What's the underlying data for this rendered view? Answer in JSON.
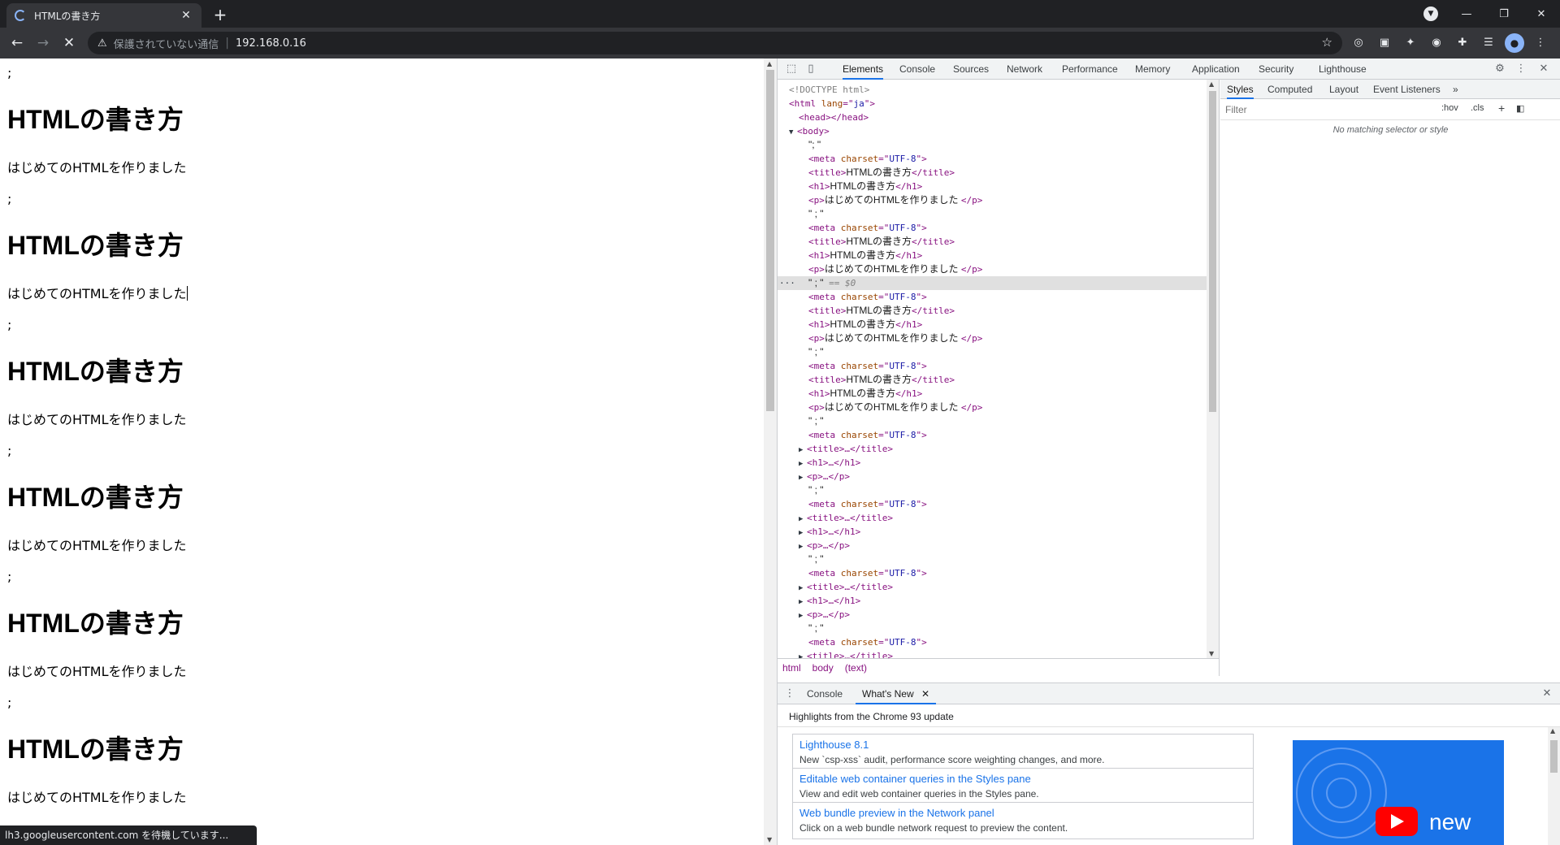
{
  "browser": {
    "tab_title": "HTMLの書き方",
    "tab_close": "✕",
    "new_tab": "+",
    "security_label": "保護されていない通信",
    "url": "192.168.0.16",
    "status_text": "lh3.googleusercontent.com を待機しています..."
  },
  "page": {
    "blocks": [
      {
        "semi": ";",
        "h1": "HTMLの書き方",
        "p": "はじめてのHTMLを作りました"
      },
      {
        "semi": ";",
        "h1": "HTMLの書き方",
        "p": "はじめてのHTMLを作りました"
      },
      {
        "semi": ";",
        "h1": "HTMLの書き方",
        "p": "はじめてのHTMLを作りました"
      },
      {
        "semi": ";",
        "h1": "HTMLの書き方",
        "p": "はじめてのHTMLを作りました"
      },
      {
        "semi": ";",
        "h1": "HTMLの書き方",
        "p": "はじめてのHTMLを作りました"
      },
      {
        "semi": ";",
        "h1": "HTMLの書き方",
        "p": "はじめてのHTMLを作りました"
      }
    ],
    "trailing_semi": ";"
  },
  "devtools": {
    "tabs": [
      "Elements",
      "Console",
      "Sources",
      "Network",
      "Performance",
      "Memory",
      "Application",
      "Security",
      "Lighthouse"
    ],
    "active_tab": "Elements",
    "dom_lines": [
      {
        "indent": 0,
        "kind": "comment",
        "text": "<!DOCTYPE html>"
      },
      {
        "indent": 0,
        "kind": "open",
        "tag": "html",
        "attr": "lang",
        "val": "ja"
      },
      {
        "indent": 1,
        "kind": "pair",
        "tag": "head",
        "inner": ""
      },
      {
        "indent": 0,
        "kind": "expanded",
        "tag": "body"
      },
      {
        "indent": 2,
        "kind": "text",
        "text": "\"; \""
      },
      {
        "indent": 2,
        "kind": "meta",
        "tag": "meta",
        "attr": "charset",
        "val": "UTF-8"
      },
      {
        "indent": 2,
        "kind": "pair",
        "tag": "title",
        "inner": "HTMLの書き方"
      },
      {
        "indent": 2,
        "kind": "pair",
        "tag": "h1",
        "inner": "HTMLの書き方"
      },
      {
        "indent": 2,
        "kind": "pair",
        "tag": "p",
        "inner": "はじめてのHTMLを作りました "
      },
      {
        "indent": 2,
        "kind": "text",
        "text": "\" ; \""
      },
      {
        "indent": 2,
        "kind": "meta",
        "tag": "meta",
        "attr": "charset",
        "val": "UTF-8"
      },
      {
        "indent": 2,
        "kind": "pair",
        "tag": "title",
        "inner": "HTMLの書き方"
      },
      {
        "indent": 2,
        "kind": "pair",
        "tag": "h1",
        "inner": "HTMLの書き方"
      },
      {
        "indent": 2,
        "kind": "pair",
        "tag": "p",
        "inner": "はじめてのHTMLを作りました "
      },
      {
        "indent": 2,
        "kind": "selected",
        "text": "\" ; \"",
        "suffix": "== $0"
      },
      {
        "indent": 2,
        "kind": "meta",
        "tag": "meta",
        "attr": "charset",
        "val": "UTF-8"
      },
      {
        "indent": 2,
        "kind": "pair",
        "tag": "title",
        "inner": "HTMLの書き方"
      },
      {
        "indent": 2,
        "kind": "pair",
        "tag": "h1",
        "inner": "HTMLの書き方"
      },
      {
        "indent": 2,
        "kind": "pair",
        "tag": "p",
        "inner": "はじめてのHTMLを作りました "
      },
      {
        "indent": 2,
        "kind": "text",
        "text": "\" ; \""
      },
      {
        "indent": 2,
        "kind": "meta",
        "tag": "meta",
        "attr": "charset",
        "val": "UTF-8"
      },
      {
        "indent": 2,
        "kind": "pair",
        "tag": "title",
        "inner": "HTMLの書き方"
      },
      {
        "indent": 2,
        "kind": "pair",
        "tag": "h1",
        "inner": "HTMLの書き方"
      },
      {
        "indent": 2,
        "kind": "pair",
        "tag": "p",
        "inner": "はじめてのHTMLを作りました "
      },
      {
        "indent": 2,
        "kind": "text",
        "text": "\" ; \""
      },
      {
        "indent": 2,
        "kind": "meta",
        "tag": "meta",
        "attr": "charset",
        "val": "UTF-8"
      },
      {
        "indent": 1,
        "kind": "collapsed",
        "tag": "title"
      },
      {
        "indent": 1,
        "kind": "collapsed",
        "tag": "h1"
      },
      {
        "indent": 1,
        "kind": "collapsed",
        "tag": "p"
      },
      {
        "indent": 2,
        "kind": "text",
        "text": "\" ; \""
      },
      {
        "indent": 2,
        "kind": "meta",
        "tag": "meta",
        "attr": "charset",
        "val": "UTF-8"
      },
      {
        "indent": 1,
        "kind": "collapsed",
        "tag": "title"
      },
      {
        "indent": 1,
        "kind": "collapsed",
        "tag": "h1"
      },
      {
        "indent": 1,
        "kind": "collapsed",
        "tag": "p"
      },
      {
        "indent": 2,
        "kind": "text",
        "text": "\" ; \""
      },
      {
        "indent": 2,
        "kind": "meta",
        "tag": "meta",
        "attr": "charset",
        "val": "UTF-8"
      },
      {
        "indent": 1,
        "kind": "collapsed",
        "tag": "title"
      },
      {
        "indent": 1,
        "kind": "collapsed",
        "tag": "h1"
      },
      {
        "indent": 1,
        "kind": "collapsed",
        "tag": "p"
      },
      {
        "indent": 2,
        "kind": "text",
        "text": "\" ; \""
      },
      {
        "indent": 2,
        "kind": "meta",
        "tag": "meta",
        "attr": "charset",
        "val": "UTF-8"
      },
      {
        "indent": 1,
        "kind": "collapsed",
        "tag": "title"
      }
    ],
    "breadcrumbs": [
      "html",
      "body",
      "(text)"
    ],
    "styles_tabs": [
      "Styles",
      "Computed",
      "Layout",
      "Event Listeners"
    ],
    "styles_more": "»",
    "filter_placeholder": "Filter",
    "hov_label": ":hov",
    "cls_label": ".cls",
    "no_match": "No matching selector or style",
    "drawer_tabs": [
      "Console",
      "What's New"
    ],
    "drawer_close": "✕",
    "highlights_title": "Highlights from the Chrome 93 update",
    "cards": [
      {
        "title": "Lighthouse 8.1",
        "desc": "New `csp-xss` audit, performance score weighting changes, and more."
      },
      {
        "title": "Editable web container queries in the Styles pane",
        "desc": "View and edit web container queries in the Styles pane."
      },
      {
        "title": "Web bundle preview in the Network panel",
        "desc": "Click on a web bundle network request to preview the content."
      }
    ],
    "promo_text": "new"
  },
  "colors": {
    "chrome_dark": "#202124",
    "accent": "#1a73e8",
    "tag": "#881280"
  }
}
